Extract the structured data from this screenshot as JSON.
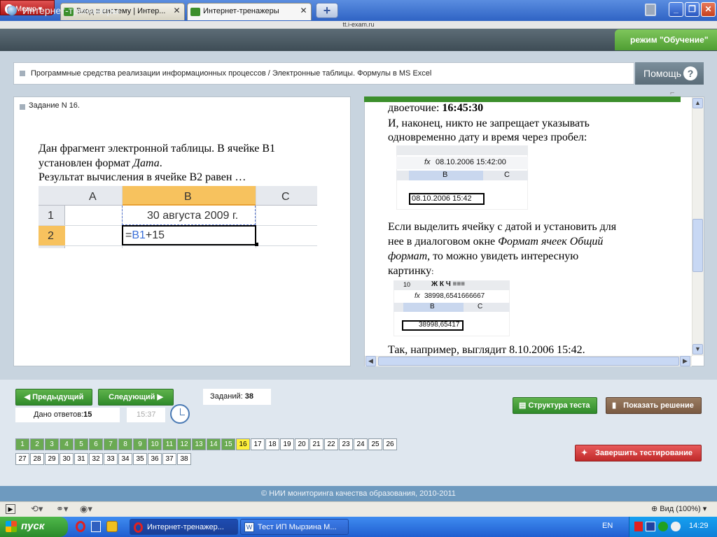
{
  "browser": {
    "menu_label": "Меню",
    "tabs": [
      {
        "title": "Вход в систему | Интер..."
      },
      {
        "title": "Интернет-тренажеры"
      }
    ],
    "url": "tt.i-exam.ru"
  },
  "app": {
    "title": "Интернет-тренажеры",
    "mode": "режим \"Обучение\"",
    "breadcrumb": "Программные средства реализации информационных процессов / Электронные таблицы. Формулы в MS Excel",
    "help_label": "Помощь"
  },
  "task": {
    "title": "Задание N 16.",
    "line1": "Дан фрагмент электронной таблицы. В ячейке B1",
    "line2a": "установлен формат",
    "line2b": "Дата",
    "line2c": ".",
    "line3": "Результат вычисления в ячейке B2 равен …",
    "sheet": {
      "col_headers": [
        "A",
        "B",
        "C"
      ],
      "rows": [
        "1",
        "2"
      ],
      "b1": "30 августа 2009 г.",
      "b2_eq": "=",
      "b2_ref": "B1",
      "b2_rest": "+15",
      "ref_color": "#3a6fd8"
    }
  },
  "hint": {
    "line_colon_a": "двоеточие: ",
    "line_colon_b": "16:45:30",
    "line2": "И, наконец, никто не запрещает указывать",
    "line3": "одновременно дату и время через пробел:",
    "img1": {
      "fx": "fx",
      "formula": "08.10.2006  15:42:00",
      "colB": "B",
      "colC": "C",
      "cell": "08.10.2006 15:42"
    },
    "line4": "Если выделить ячейку с датой и установить для",
    "line5a": "нее в диалоговом окне ",
    "line5b": "Формат ячеек Общий",
    "line6a": "формат",
    "line6b": ", то можно увидеть интересную",
    "line7a": "картинку",
    "line7b": ":",
    "img2": {
      "toolbar": "10",
      "fx": "fx",
      "formula": "38998,6541666667",
      "colB": "B",
      "colC": "C",
      "cell": "38998,65417"
    },
    "line8": "Так, например, выглядит 8.10.2006 15:42."
  },
  "controls": {
    "prev_label": "Предыдущий",
    "next_label": "Следующий",
    "answers_label": "Дано ответов:",
    "answers_value": "15",
    "time": "15:37",
    "tasks_label": "Заданий:",
    "tasks_value": "38",
    "structure_label": "Структура теста",
    "solution_label": "Показать решение",
    "finish_label": "Завершить тестирование"
  },
  "question_numbers": {
    "row1": [
      "1",
      "2",
      "3",
      "4",
      "5",
      "6",
      "7",
      "8",
      "9",
      "10",
      "11",
      "12",
      "13",
      "14",
      "15",
      "16",
      "17",
      "18",
      "19",
      "20",
      "21",
      "22",
      "23",
      "24",
      "25",
      "26"
    ],
    "row2": [
      "27",
      "28",
      "29",
      "30",
      "31",
      "32",
      "33",
      "34",
      "35",
      "36",
      "37",
      "38"
    ],
    "answered_until": 15,
    "current": 16
  },
  "footer": "© НИИ мониторинга качества образования, 2010-2011",
  "statusbar": {
    "zoom": "Вид (100%)"
  },
  "taskbar": {
    "start": "пуск",
    "items": [
      {
        "label": "Интернет-тренажер..."
      },
      {
        "label": "Тест ИП Мырзина М..."
      }
    ],
    "lang": "EN",
    "clock": "14:29"
  },
  "colors": {
    "accent_green": "#3c8f2c",
    "current_question": "#ffef3a",
    "finish_red": "#d83a3a",
    "solution_brown": "#8a6a50"
  }
}
